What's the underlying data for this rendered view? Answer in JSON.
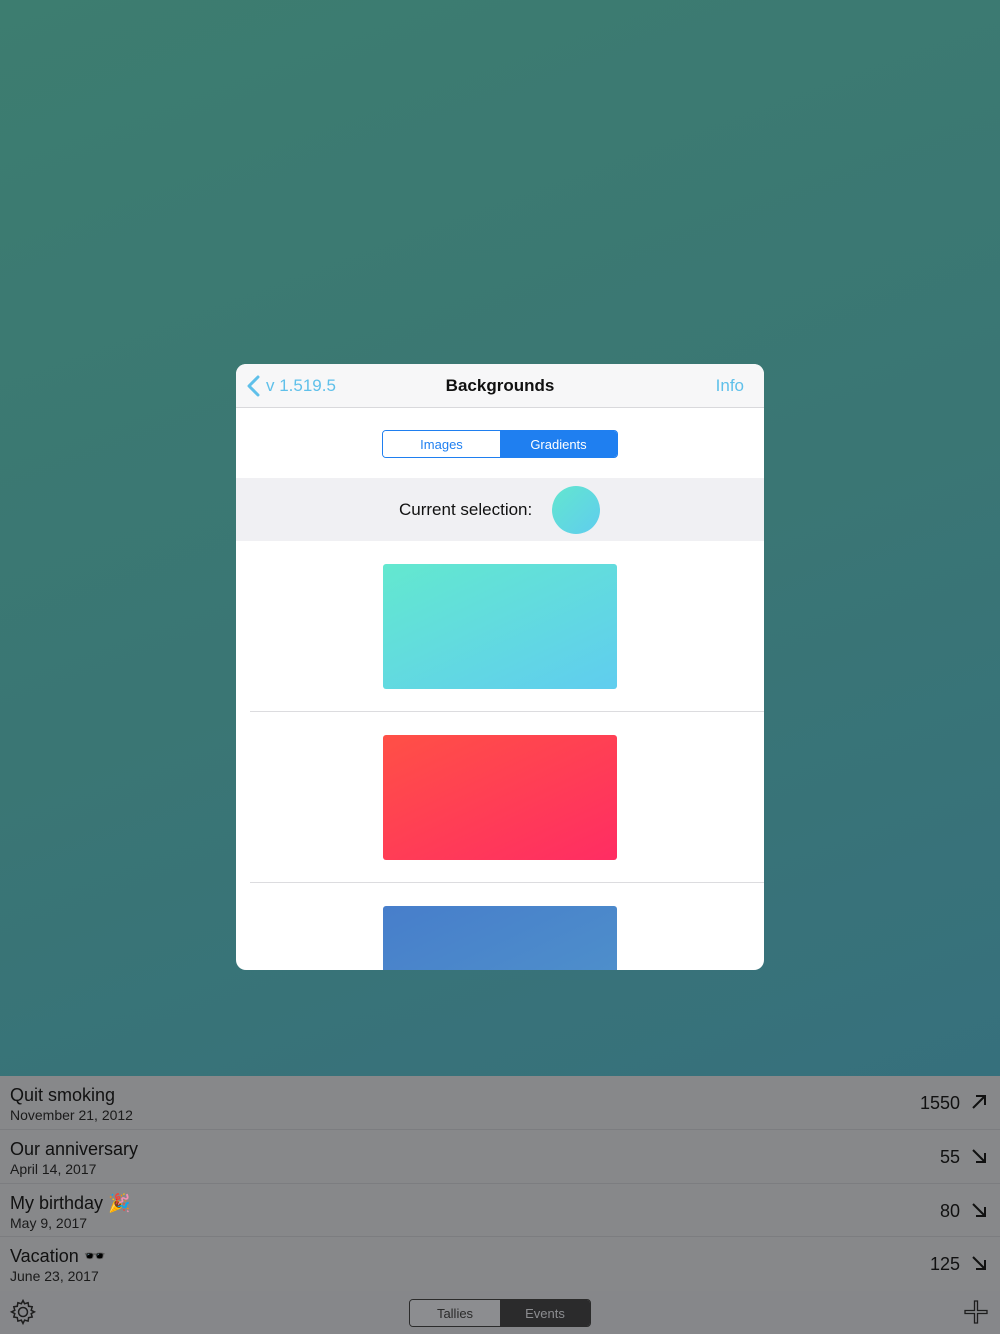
{
  "modal": {
    "back_label": "v 1.519.5",
    "title": "Backgrounds",
    "info_label": "Info",
    "segments": [
      "Images",
      "Gradients"
    ],
    "selected_segment": "Gradients",
    "current_selection_label": "Current selection:"
  },
  "gradients": [
    {
      "from": "#63e8cf",
      "to": "#60cdef"
    },
    {
      "from": "#ff5046",
      "to": "#ff2d63"
    },
    {
      "from": "#477ecb",
      "to": "#5094cb"
    }
  ],
  "events": [
    {
      "title": "Quit smoking",
      "date": "November 21, 2012",
      "count": "1550",
      "direction": "up"
    },
    {
      "title": "Our anniversary",
      "date": "April 14, 2017",
      "count": "55",
      "direction": "down"
    },
    {
      "title": "My birthday 🎉",
      "date": "May 9, 2017",
      "count": "80",
      "direction": "down"
    },
    {
      "title": "Vacation 🕶️",
      "date": "June 23, 2017",
      "count": "125",
      "direction": "down"
    }
  ],
  "toolbar": {
    "tabs": [
      "Tallies",
      "Events"
    ],
    "selected_tab": "Events"
  },
  "colors": {
    "accent": "#1f7ff0",
    "link": "#5fc0ea"
  }
}
